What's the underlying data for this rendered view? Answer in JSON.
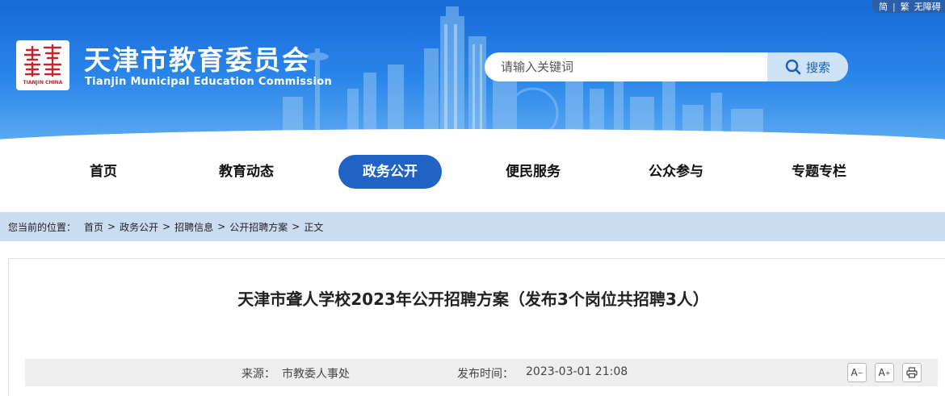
{
  "lang_bar": {
    "simplified": "简",
    "traditional": "繁",
    "accessible": "无障碍"
  },
  "header": {
    "logo_caption": "TIANJIN CHINA",
    "title": "天津市教育委员会",
    "subtitle": "Tianjin Municipal Education Commission"
  },
  "search": {
    "placeholder": "请输入关键词",
    "button_label": "搜索"
  },
  "nav": {
    "items": [
      {
        "label": "首页",
        "active": false
      },
      {
        "label": "教育动态",
        "active": false
      },
      {
        "label": "政务公开",
        "active": true
      },
      {
        "label": "便民服务",
        "active": false
      },
      {
        "label": "公众参与",
        "active": false
      },
      {
        "label": "专题专栏",
        "active": false
      }
    ]
  },
  "breadcrumb": {
    "label": "您当前的位置：",
    "items": [
      "首页",
      "政务公开",
      "招聘信息",
      "公开招聘方案",
      "正文"
    ],
    "separator": ">"
  },
  "article": {
    "title": "天津市聋人学校2023年公开招聘方案（发布3个岗位共招聘3人）",
    "source_label": "来源：",
    "source": "市教委人事处",
    "time_label": "发布时间：",
    "time": "2023-03-01 21:08"
  },
  "tools": {
    "font_decrease": "A",
    "font_increase": "A",
    "decrease_mark": "−",
    "increase_mark": "+"
  },
  "colors": {
    "header_blue": "#1769d6",
    "nav_active": "#1f63c4",
    "breadcrumb_bg": "#c9dcf2",
    "seal_red": "#c6252b"
  }
}
